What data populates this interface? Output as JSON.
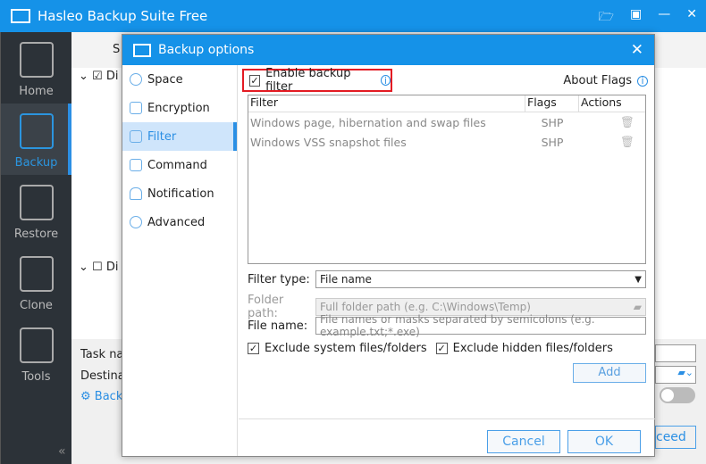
{
  "app": {
    "title": "Hasleo Backup Suite Free"
  },
  "nav": {
    "items": [
      {
        "label": "Home"
      },
      {
        "label": "Backup"
      },
      {
        "label": "Restore"
      },
      {
        "label": "Clone"
      },
      {
        "label": "Tools"
      }
    ],
    "active": "Backup"
  },
  "background": {
    "header_partial": "S",
    "tree_item1": "Di",
    "tree_item2": "Di",
    "task_name": "Task na",
    "destination": "Destinat",
    "back_link": "Back",
    "proceed_partial": "ceed"
  },
  "dialog": {
    "title": "Backup options",
    "menu": [
      {
        "label": "Space"
      },
      {
        "label": "Encryption"
      },
      {
        "label": "Filter"
      },
      {
        "label": "Command"
      },
      {
        "label": "Notification"
      },
      {
        "label": "Advanced"
      }
    ],
    "active_menu": "Filter",
    "enable_filter": {
      "label": "Enable backup filter",
      "checked": true
    },
    "about_flags": "About Flags",
    "table": {
      "headers": [
        "Filter",
        "Flags",
        "Actions"
      ],
      "rows": [
        {
          "filter": "Windows page, hibernation and swap files",
          "flags": "SHP"
        },
        {
          "filter": "Windows VSS snapshot files",
          "flags": "SHP"
        }
      ]
    },
    "filter_type": {
      "label": "Filter type:",
      "value": "File name"
    },
    "folder_path": {
      "label": "Folder path:",
      "placeholder": "Full folder path (e.g. C:\\Windows\\Temp)"
    },
    "file_name": {
      "label": "File name:",
      "placeholder": "File names or masks separated by semicolons (e.g. example.txt;*.exe)"
    },
    "exclude_system": {
      "label": "Exclude system files/folders",
      "checked": true
    },
    "exclude_hidden": {
      "label": "Exclude hidden files/folders",
      "checked": true
    },
    "add": "Add",
    "cancel": "Cancel",
    "ok": "OK"
  },
  "colors": {
    "accent": "#1592e8",
    "highlight": "#e31b23",
    "nav_bg": "#2c3238"
  }
}
